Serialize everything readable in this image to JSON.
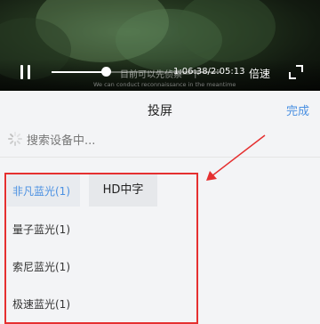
{
  "player": {
    "subtitle_cn": "目前可以先侦察一下",
    "subtitle_en": "We can conduct reconnaissance in the meantime",
    "time_display": "1:06:38/2:05:13",
    "progress": 0.32,
    "speed_label": "倍速"
  },
  "cast_panel": {
    "title": "投屏",
    "done_label": "完成",
    "searching_label": "搜索设备中...",
    "quality_label": "HD中字",
    "devices": [
      {
        "label": "非凡蓝光(1)",
        "selected": true
      },
      {
        "label": "量子蓝光(1)",
        "selected": false
      },
      {
        "label": "索尼蓝光(1)",
        "selected": false
      },
      {
        "label": "极速蓝光(1)",
        "selected": false
      }
    ]
  },
  "colors": {
    "accent": "#4a90e2",
    "annotation_red": "#e53030"
  }
}
